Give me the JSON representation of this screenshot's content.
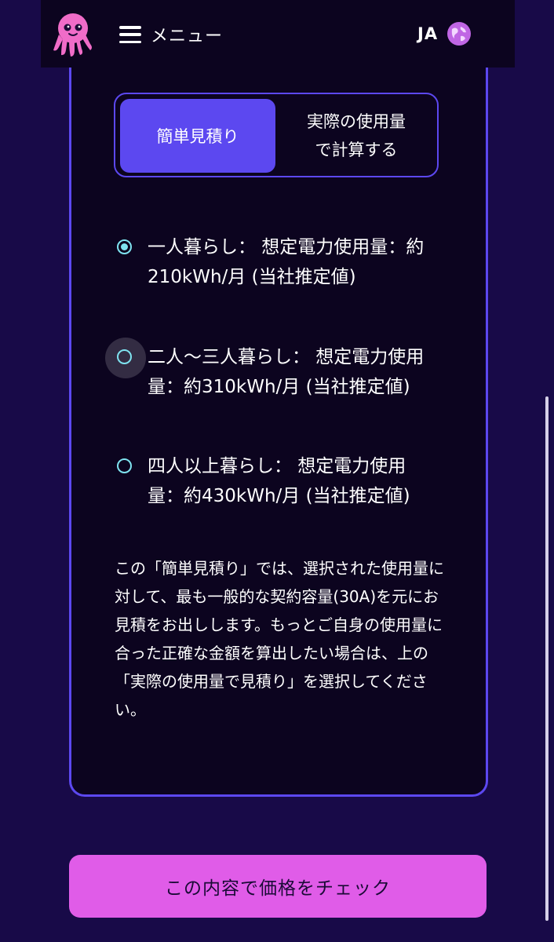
{
  "header": {
    "menu_label": "メニュー",
    "language": "JA",
    "icons": [
      "octopus-logo",
      "hamburger-icon",
      "globe-icon"
    ]
  },
  "toggle": {
    "active_label": "簡単見積り",
    "inactive_line1": "実際の使用量",
    "inactive_line2": "で計算する"
  },
  "options": [
    {
      "label": "一人暮らし： 想定電力使用量：約210kWh/月 (当社推定値)",
      "selected": true
    },
    {
      "label": "二人〜三人暮らし： 想定電力使用量：約310kWh/月 (当社推定値)",
      "selected": false
    },
    {
      "label": "四人以上暮らし： 想定電力使用量：約430kWh/月 (当社推定値)",
      "selected": false
    }
  ],
  "note": "この「簡単見積り」では、選択された使用量に対して、最も一般的な契約容量(30A)を元にお見積をお出しします。もっとご自身の使用量に合った正確な金額を算出したい場合は、上の「実際の使用量で見積り」を選択してください。",
  "cta_label": "この内容で価格をチェック",
  "colors": {
    "background": "#180a48",
    "panel": "#0c041f",
    "accent": "#5c48f0",
    "radio": "#7fe3f0",
    "cta": "#e05ce8"
  }
}
